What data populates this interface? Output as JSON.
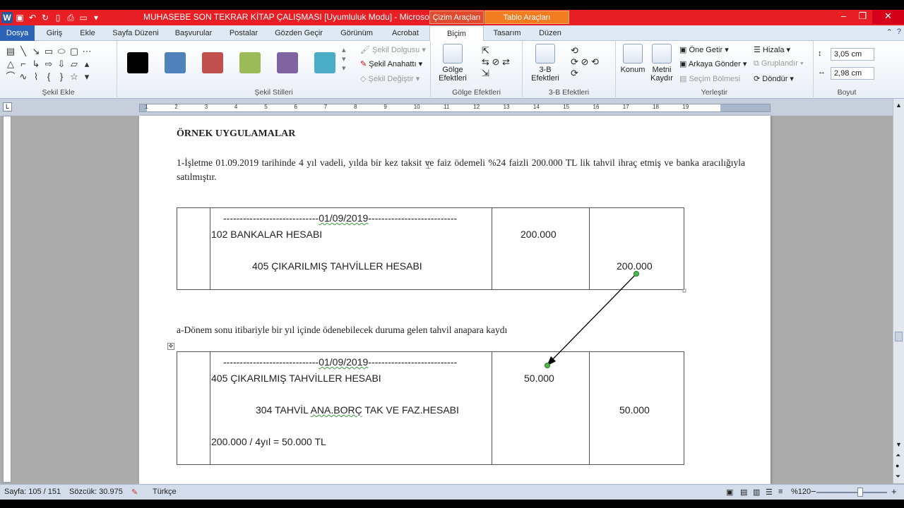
{
  "window": {
    "title": "MUHASEBE SON TEKRAR KİTAP ÇALIŞMASI [Uyumluluk Modu]  -  Microsoft ...",
    "context_tab_drawing": "Çizim Araçları",
    "context_tab_table": "Tablo Araçları"
  },
  "tabs": [
    "Dosya",
    "Giriş",
    "Ekle",
    "Sayfa Düzeni",
    "Başvurular",
    "Postalar",
    "Gözden Geçir",
    "Görünüm",
    "Acrobat",
    "Biçim",
    "Tasarım",
    "Düzen"
  ],
  "ribbon": {
    "groups": {
      "insert_shapes": "Şekil Ekle",
      "shape_styles": "Şekil Stilleri",
      "shadow_effects": "Gölge Efektleri",
      "effects_3d": "3-B Efektleri",
      "arrange": "Yerleştir",
      "size": "Boyut"
    },
    "style_colors": [
      "#000000",
      "#4f81bd",
      "#c0504d",
      "#9bbb59",
      "#8064a2",
      "#4bacc6"
    ],
    "shape_fill": "Şekil Dolgusu",
    "shape_outline": "Şekil Anahattı",
    "change_shape": "Şekil Değiştir",
    "shadow_effects_btn": "Gölge Efektleri",
    "effects_3d_btn": "3-B Efektleri",
    "position": "Konum",
    "wrap_text": "Metni Kaydır",
    "bring_forward": "Öne Getir",
    "send_backward": "Arkaya Gönder",
    "selection_pane": "Seçim Bölmesi",
    "align": "Hizala",
    "group": "Gruplandır",
    "rotate": "Döndür",
    "height": "3,05 cm",
    "width": "2,98 cm"
  },
  "document": {
    "heading": "ÖRNEK UYGULAMALAR",
    "paragraph": "1-İşletme 01.09.2019 tarihinde 4 yıl vadeli, yılda bir kez taksit ve faiz ödemeli %24 faizli 200.000 TL lik tahvil ihraç etmiş ve banka aracılığıyla  satılmıştır.",
    "entry1": {
      "date_dashes_left": "-----------------------------",
      "date": "01/09/2019",
      "date_dashes_right": "---------------------------",
      "debit_account": "102 BANKALAR HESABI",
      "credit_account": "405 ÇIKARILMIŞ TAHVİLLER HESABI",
      "debit_amount": "200.000",
      "credit_amount": "200.000"
    },
    "subheading": "a-Dönem sonu itibariyle bir yıl içinde ödenebilecek duruma gelen tahvil anapara kaydı",
    "entry2": {
      "date_dashes_left": "-----------------------------",
      "date": "01/09/2019",
      "date_dashes_right": "---------------------------",
      "debit_account": "405 ÇIKARILMIŞ TAHVİLLER HESABI",
      "credit_account_pre": "304 TAHVİL ",
      "credit_account_squig": "ANA.BORÇ",
      "credit_account_post": " TAK VE FAZ.HESABI",
      "note": "200.000 / 4yıl = 50.000 TL",
      "debit_amount": "50.000",
      "credit_amount": "50.000"
    }
  },
  "status": {
    "page": "Sayfa: 105 / 151",
    "words": "Sözcük: 30.975",
    "language": "Türkçe",
    "zoom": "%120"
  }
}
